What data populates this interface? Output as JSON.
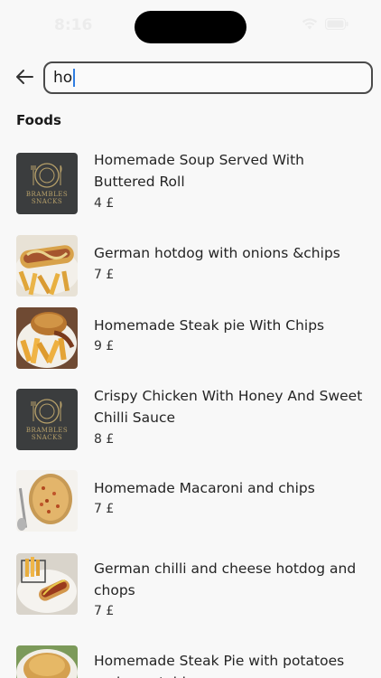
{
  "status_bar": {
    "time": "8:16",
    "icons": [
      "wifi-icon",
      "battery-icon"
    ]
  },
  "search": {
    "value": "ho",
    "back_icon": "arrow-left-icon"
  },
  "section": {
    "title": "Foods"
  },
  "foods": [
    {
      "name": "Homemade Soup Served With Buttered Roll",
      "price": "4 £",
      "thumb": "brambles-logo",
      "logo_text": "BRAMBLES\nSNACKS"
    },
    {
      "name": "German hotdog with onions &chips",
      "price": "7 £",
      "thumb": "photo-hotdog"
    },
    {
      "name": "Homemade Steak pie With Chips",
      "price": "9 £",
      "thumb": "photo-steak-pie"
    },
    {
      "name": "Crispy Chicken With Honey And Sweet Chilli Sauce",
      "price": "8 £",
      "thumb": "brambles-logo",
      "logo_text": "BRAMBLES\nSNACKS"
    },
    {
      "name": "Homemade Macaroni and chips",
      "price": "7 £",
      "thumb": "photo-macaroni"
    },
    {
      "name": "German chilli and cheese hotdog and chops",
      "price": "7 £",
      "thumb": "photo-chilli-hotdog"
    },
    {
      "name": "Homemade Steak Pie with potatoes and vegetables",
      "price": "",
      "thumb": "photo-pie"
    }
  ],
  "colors": {
    "background": "#f8f8f8",
    "logo_bg": "#3b3d3e",
    "logo_gold": "#b8a16a",
    "caret": "#2f7de1"
  }
}
